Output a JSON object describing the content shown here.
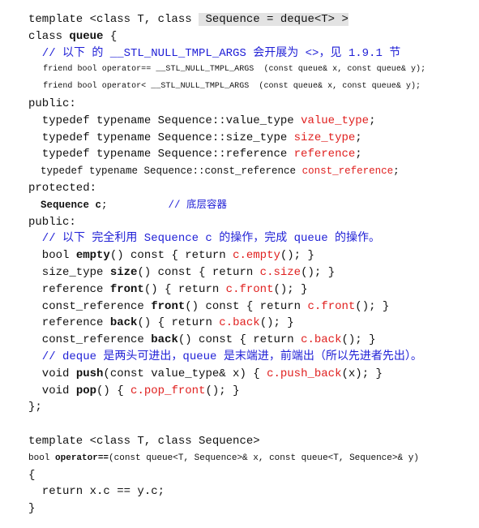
{
  "colors": {
    "comment": "#1f1fd6",
    "member": "#e0201f",
    "highlight": "#e3e3e3"
  },
  "lines": [
    {
      "segs": [
        {
          "t": "template <class T, class "
        },
        {
          "t": " Sequence = deque<T> >",
          "s": "h"
        }
      ]
    },
    {
      "segs": [
        {
          "t": "class "
        },
        {
          "t": "queue",
          "s": "b"
        },
        {
          "t": " {"
        }
      ]
    },
    {
      "segs": [
        {
          "t": "  // 以下 的 __STL_NULL_TMPL_ARGS 会开展为 <>，见 1.9.1 节",
          "s": "c"
        }
      ]
    },
    {
      "size": "sm",
      "segs": [
        {
          "t": "   friend bool operator== __STL_NULL_TMPL_ARGS  (const queue& x, const queue& y);"
        }
      ]
    },
    {
      "size": "sm",
      "segs": [
        {
          "t": "   friend bool operator< __STL_NULL_TMPL_ARGS  (const queue& x, const queue& y);"
        }
      ]
    },
    {
      "segs": [
        {
          "t": "public:"
        }
      ]
    },
    {
      "segs": [
        {
          "t": "  typedef typename Sequence::value_type "
        },
        {
          "t": "value_type",
          "s": "r"
        },
        {
          "t": ";"
        }
      ]
    },
    {
      "segs": [
        {
          "t": "  typedef typename Sequence::size_type "
        },
        {
          "t": "size_type",
          "s": "r"
        },
        {
          "t": ";"
        }
      ]
    },
    {
      "segs": [
        {
          "t": "  typedef typename Sequence::reference "
        },
        {
          "t": "reference",
          "s": "r"
        },
        {
          "t": ";"
        }
      ]
    },
    {
      "size": "md",
      "segs": [
        {
          "t": "  typedef typename Sequence::const_reference "
        },
        {
          "t": "const_reference",
          "s": "r"
        },
        {
          "t": ";"
        }
      ]
    },
    {
      "segs": [
        {
          "t": "protected:"
        }
      ]
    },
    {
      "size": "md",
      "segs": [
        {
          "t": "  "
        },
        {
          "t": "Sequence c",
          "s": "b"
        },
        {
          "t": ";          "
        },
        {
          "t": "// 底层容器",
          "s": "c"
        }
      ]
    },
    {
      "segs": [
        {
          "t": "public:"
        }
      ]
    },
    {
      "segs": [
        {
          "t": "  // 以下 完全利用 Sequence c 的操作，完成 queue 的操作。",
          "s": "c"
        }
      ]
    },
    {
      "segs": [
        {
          "t": "  bool "
        },
        {
          "t": "empty",
          "s": "b"
        },
        {
          "t": "() const { return "
        },
        {
          "t": "c.empty",
          "s": "r"
        },
        {
          "t": "(); }"
        }
      ]
    },
    {
      "segs": [
        {
          "t": "  size_type "
        },
        {
          "t": "size",
          "s": "b"
        },
        {
          "t": "() const { return "
        },
        {
          "t": "c.size",
          "s": "r"
        },
        {
          "t": "(); }"
        }
      ]
    },
    {
      "segs": [
        {
          "t": "  reference "
        },
        {
          "t": "front",
          "s": "b"
        },
        {
          "t": "() { return "
        },
        {
          "t": "c.front",
          "s": "r"
        },
        {
          "t": "(); }"
        }
      ]
    },
    {
      "segs": [
        {
          "t": "  const_reference "
        },
        {
          "t": "front",
          "s": "b"
        },
        {
          "t": "() const { return "
        },
        {
          "t": "c.front",
          "s": "r"
        },
        {
          "t": "(); }"
        }
      ]
    },
    {
      "segs": [
        {
          "t": "  reference "
        },
        {
          "t": "back",
          "s": "b"
        },
        {
          "t": "() { return "
        },
        {
          "t": "c.back",
          "s": "r"
        },
        {
          "t": "(); }"
        }
      ]
    },
    {
      "segs": [
        {
          "t": "  const_reference "
        },
        {
          "t": "back",
          "s": "b"
        },
        {
          "t": "() const { return "
        },
        {
          "t": "c.back",
          "s": "r"
        },
        {
          "t": "(); }"
        }
      ]
    },
    {
      "segs": [
        {
          "t": "  // deque 是两头可进出，queue 是末端进，前端出（所以先进者先出）。",
          "s": "c"
        }
      ]
    },
    {
      "segs": [
        {
          "t": "  void "
        },
        {
          "t": "push",
          "s": "b"
        },
        {
          "t": "(const value_type& x) { "
        },
        {
          "t": "c.push_back",
          "s": "r"
        },
        {
          "t": "(x); }"
        }
      ]
    },
    {
      "segs": [
        {
          "t": "  void "
        },
        {
          "t": "pop",
          "s": "b"
        },
        {
          "t": "() { "
        },
        {
          "t": "c.pop_front",
          "s": "r"
        },
        {
          "t": "(); }"
        }
      ]
    },
    {
      "segs": [
        {
          "t": "};"
        }
      ]
    },
    {
      "segs": [
        {
          "t": ""
        }
      ]
    },
    {
      "segs": [
        {
          "t": "template <class T, class Sequence>"
        }
      ]
    },
    {
      "size": "op",
      "segs": [
        {
          "t": "bool "
        },
        {
          "t": "operator==",
          "s": "b"
        },
        {
          "t": "(const queue<T, Sequence>& x, const queue<T, Sequence>& y)"
        }
      ]
    },
    {
      "segs": [
        {
          "t": "{"
        }
      ]
    },
    {
      "segs": [
        {
          "t": "  return x.c == y.c;"
        }
      ]
    },
    {
      "segs": [
        {
          "t": "}"
        }
      ]
    }
  ]
}
